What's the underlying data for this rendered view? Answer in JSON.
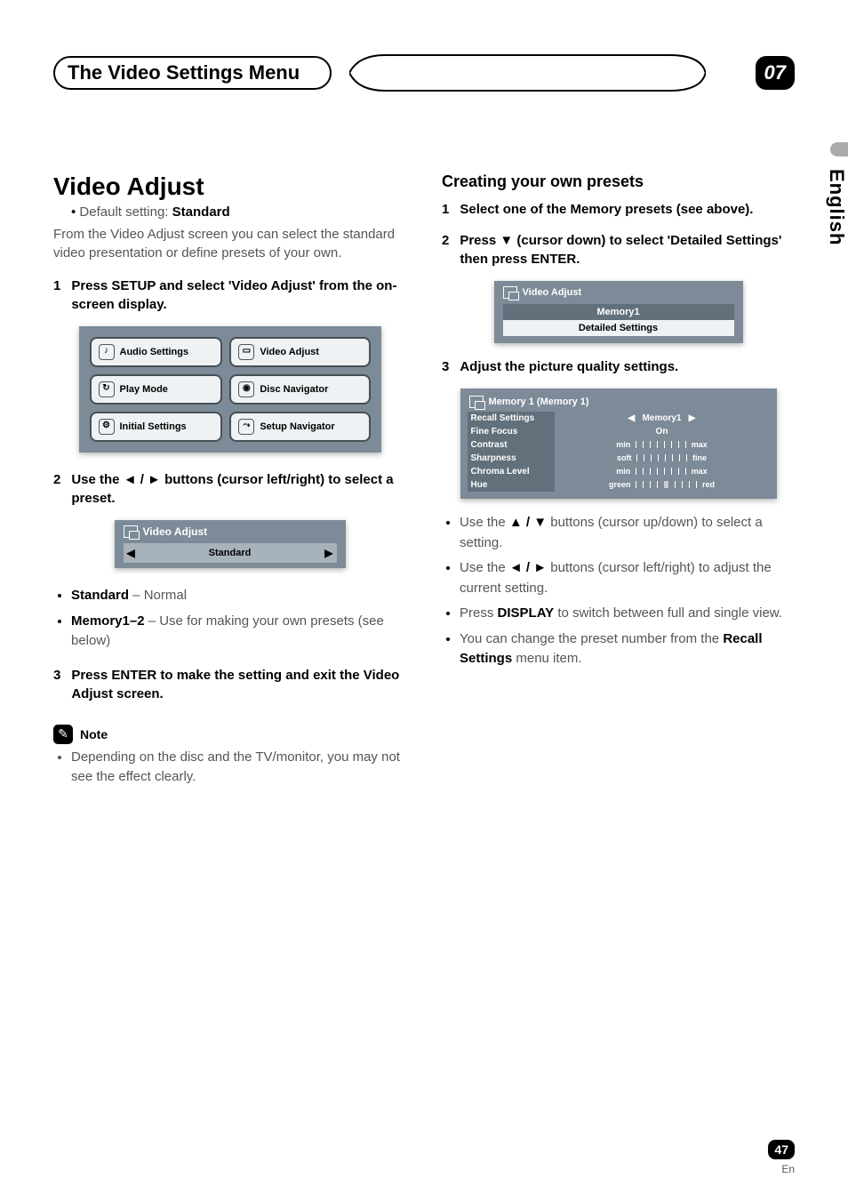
{
  "header": {
    "title": "The Video Settings Menu",
    "chapter": "07"
  },
  "side_tab": "English",
  "left": {
    "h1": "Video Adjust",
    "default_line_prefix": "Default setting: ",
    "default_value": "Standard",
    "intro": "From the Video Adjust screen you can select the standard video presentation or define presets of your own.",
    "step1": {
      "num": "1",
      "text": "Press SETUP and select 'Video Adjust' from the on-screen display."
    },
    "osd_menu": {
      "audio": "Audio Settings",
      "video": "Video Adjust",
      "play": "Play Mode",
      "disc": "Disc Navigator",
      "initial": "Initial Settings",
      "setup": "Setup Navigator"
    },
    "step2": {
      "num": "2",
      "text_a": "Use the ",
      "text_b": " buttons (cursor left/right) to select a preset."
    },
    "osd_preset": {
      "header": "Video Adjust",
      "value": "Standard"
    },
    "presets": [
      {
        "name": "Standard",
        "desc": " – Normal"
      },
      {
        "name": "Memory1–2",
        "desc": " – Use for making your own presets (see below)"
      }
    ],
    "step3": {
      "num": "3",
      "text": "Press ENTER to make the setting and exit the Video Adjust screen."
    },
    "note_label": "Note",
    "note_text": "Depending on the disc and the TV/monitor, you may not see the effect clearly."
  },
  "right": {
    "h2": "Creating your own presets",
    "step1": {
      "num": "1",
      "text": "Select one of the Memory presets (see above)."
    },
    "step2": {
      "num": "2",
      "text_a": "Press ",
      "text_b": " (cursor down) to select 'Detailed Settings' then press ENTER."
    },
    "osd_mem": {
      "header": "Video Adjust",
      "mid": "Memory1",
      "sub": "Detailed Settings"
    },
    "step3": {
      "num": "3",
      "text": "Adjust the picture quality settings."
    },
    "osd_detail": {
      "header": "Memory 1 (Memory 1)",
      "rows": {
        "recall_label": "Recall Settings",
        "recall_value": "Memory1",
        "fine_label": "Fine Focus",
        "fine_value": "On",
        "contrast_label": "Contrast",
        "contrast_left": "min",
        "contrast_right": "max",
        "sharp_label": "Sharpness",
        "sharp_left": "soft",
        "sharp_right": "fine",
        "chroma_label": "Chroma Level",
        "chroma_left": "min",
        "chroma_right": "max",
        "hue_label": "Hue",
        "hue_left": "green",
        "hue_right": "red"
      }
    },
    "bullets": {
      "b1a": "Use the ",
      "b1b": " buttons (cursor up/down) to select a setting.",
      "b2a": "Use the ",
      "b2b": " buttons (cursor left/right) to adjust the current setting.",
      "b3a": "Press ",
      "b3b": "DISPLAY",
      "b3c": " to switch between full and single view.",
      "b4a": "You can change the preset number from the ",
      "b4b": "Recall Settings",
      "b4c": " menu item."
    }
  },
  "footer": {
    "page": "47",
    "lang": "En"
  },
  "glyphs": {
    "left_right": "◄ / ►",
    "down": "▼",
    "up_down": "▲ / ▼",
    "tri_left": "◀",
    "tri_right": "▶",
    "pencil": "✎"
  }
}
